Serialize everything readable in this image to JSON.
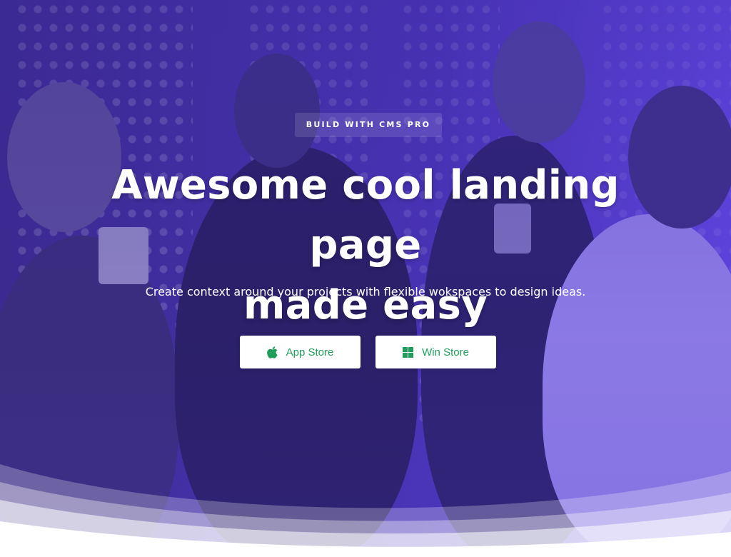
{
  "hero": {
    "badge": "BUILD WITH CMS PRO",
    "headline_line1": "Awesome cool landing page",
    "headline_line2": "made easy",
    "subtitle": "Create context around your projects with flexible wokspaces to design ideas."
  },
  "buttons": [
    {
      "label": "App Store",
      "icon": "apple-icon"
    },
    {
      "label": "Win Store",
      "icon": "windows-icon"
    }
  ],
  "colors": {
    "overlay": "#4330a6",
    "button_text": "#1f9e5b",
    "button_bg": "#ffffff"
  }
}
